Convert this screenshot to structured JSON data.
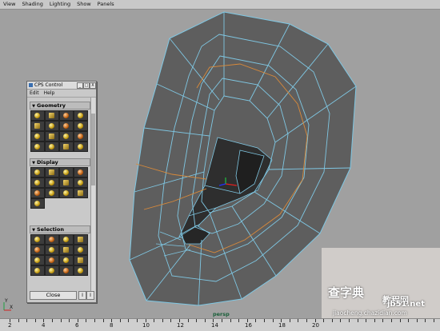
{
  "menubar": {
    "items": [
      "View",
      "Shading",
      "Lighting",
      "Show",
      "Panels"
    ]
  },
  "viewport": {
    "camera_label": "persp",
    "axis_y": "Y",
    "axis_x": "X"
  },
  "cps_panel": {
    "title": "CPS Control",
    "minimize": "_",
    "maximize": "□",
    "close": "X",
    "menu": [
      "Edit",
      "Help"
    ],
    "sections": [
      "Geometry",
      "Display",
      "Selection"
    ],
    "close_label": "Close",
    "btn1": "I",
    "btn2": "I"
  },
  "timeline": {
    "labels": [
      "2",
      "4",
      "6",
      "8",
      "10",
      "12",
      "14",
      "16",
      "18",
      "20"
    ]
  },
  "watermark": {
    "line1": "查字典",
    "line2": "教程网",
    "line3": "jiaocheng.chazidian.com",
    "site": "jb51.net"
  },
  "colors": {
    "viewport_bg": "#a0a0a0",
    "mesh_face": "#5e5e5e",
    "mesh_edge": "#7fc7e3",
    "seam_edge": "#d98a3a"
  }
}
